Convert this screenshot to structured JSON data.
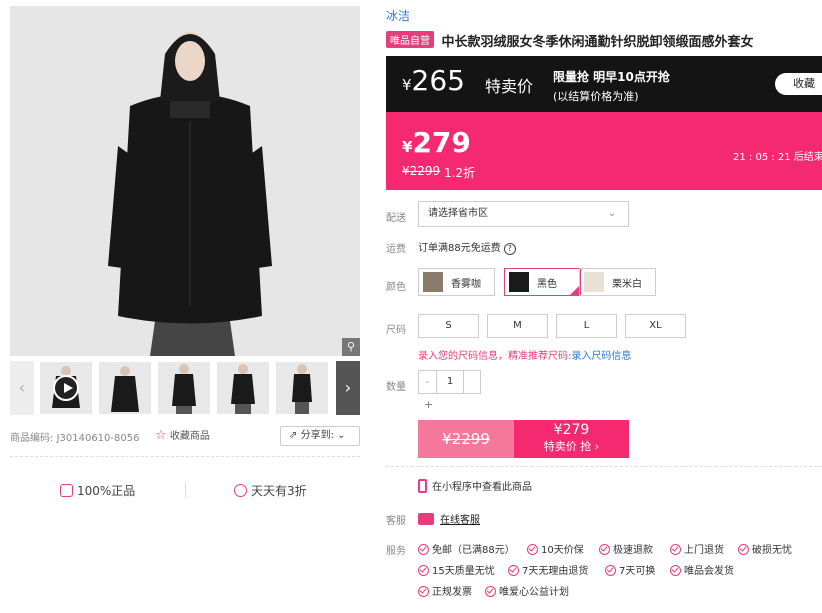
{
  "left": {
    "code_label": "商品编码:",
    "code_value": "J30140610-8056",
    "fav_label": "收藏商品",
    "share_label": "分享到:",
    "promise1": "100%正品",
    "promise2": "天天有3折"
  },
  "product": {
    "brand": "冰洁",
    "self_tag": "唯品自营",
    "title": "中长款羽绒服女冬季休闲通勤针织脱卸领缎面感外套女"
  },
  "flash": {
    "yen": "¥",
    "price": "265",
    "label": "特卖价",
    "info1": "限量抢 明早10点开抢",
    "info2": "(以结算价格为准)",
    "fav_button": "收藏"
  },
  "sale": {
    "yen": "¥",
    "price": "279",
    "original": "¥2299",
    "discount": "1.2折",
    "timer": "21 : 05 : 21 后结束"
  },
  "labels": {
    "delivery": "配送",
    "shipping": "运费",
    "color": "颜色",
    "size": "尺码",
    "quantity": "数量",
    "service": "客服",
    "services": "服务"
  },
  "delivery": {
    "placeholder": "请选择省市区",
    "chevron": "⌄"
  },
  "shipping_text": "订单满88元免运费",
  "colors": [
    {
      "name": "香雾咖",
      "swatch": "#8a7b6a"
    },
    {
      "name": "黑色",
      "swatch": "#1a1a1a"
    },
    {
      "name": "栗米白",
      "swatch": "#e8e2d4"
    }
  ],
  "sizes": [
    "S",
    "M",
    "L",
    "XL"
  ],
  "size_note": {
    "text": "录入您的尺码信息，精准推荐尺码:",
    "link": "录入尺码信息"
  },
  "quantity": {
    "minus": "-",
    "value": "1",
    "plus": "+"
  },
  "buy": {
    "original": "¥2299",
    "price": "¥279",
    "label": "特卖价 抢 ›"
  },
  "mini_program": "在小程序中查看此商品",
  "service_link": "在线客服",
  "service_items": [
    "免邮（已满88元）",
    "10天价保",
    "极速退款",
    "上门退货",
    "破损无忧",
    "15天质量无忧",
    "7天无理由退货",
    "7天可换",
    "唯品会发货",
    "正规发票",
    "唯爱心公益计划"
  ]
}
